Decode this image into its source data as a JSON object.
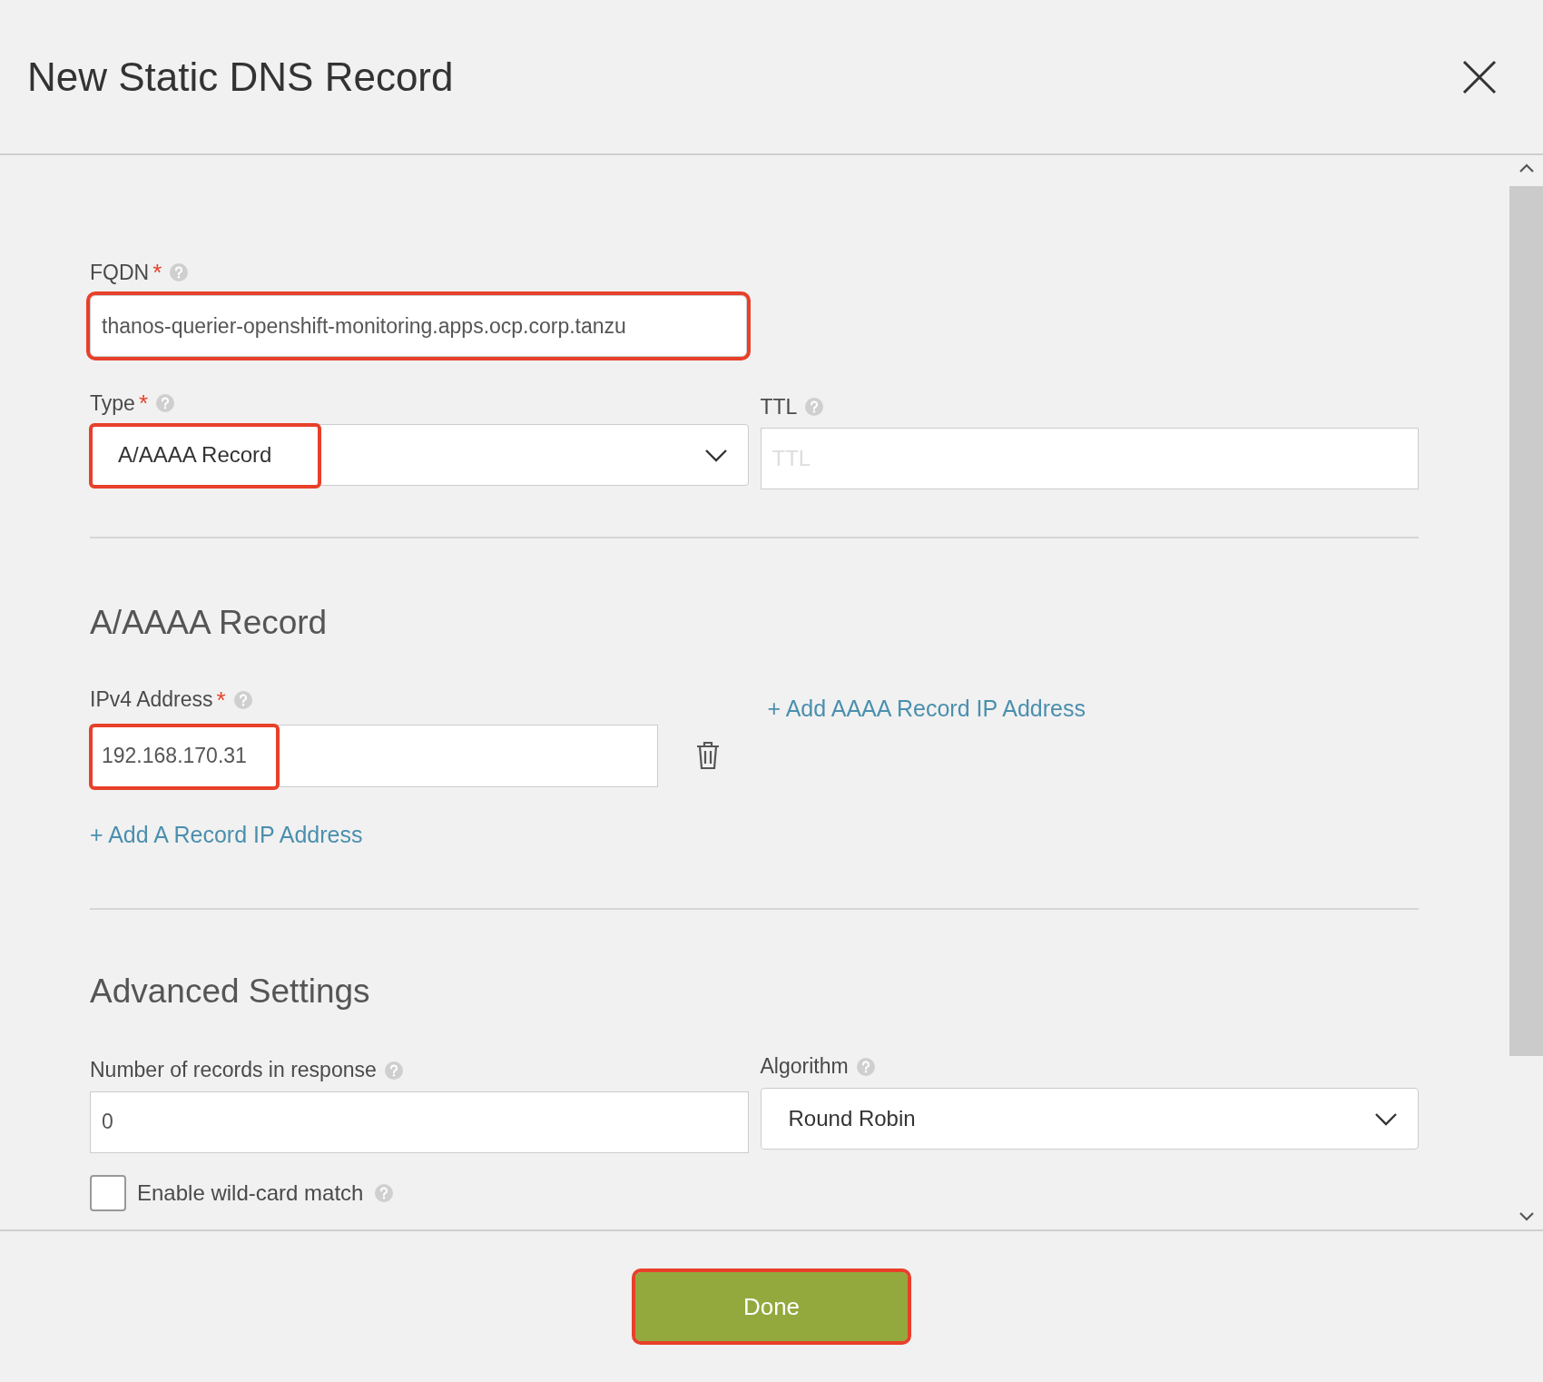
{
  "dialog": {
    "title": "New Static DNS Record"
  },
  "fqdn": {
    "label": "FQDN",
    "required_mark": "*",
    "value": "thanos-querier-openshift-monitoring.apps.ocp.corp.tanzu",
    "highlighted": true
  },
  "type": {
    "label": "Type",
    "required_mark": "*",
    "value": "A/AAAA Record",
    "highlighted": true
  },
  "ttl": {
    "label": "TTL",
    "placeholder": "TTL"
  },
  "a_record": {
    "heading": "A/AAAA Record",
    "ipv4": {
      "label": "IPv4 Address",
      "required_mark": "*",
      "value": "192.168.170.31",
      "highlighted": true
    },
    "add_a_link": "+ Add A Record IP Address",
    "add_aaaa_link": "+ Add AAAA Record IP Address"
  },
  "advanced": {
    "heading": "Advanced Settings",
    "records": {
      "label": "Number of records in response",
      "value": "0"
    },
    "algorithm": {
      "label": "Algorithm",
      "value": "Round Robin"
    },
    "wildcard": {
      "label": "Enable wild-card match",
      "checked": false
    }
  },
  "done_button": {
    "label": "Done",
    "highlighted": true
  }
}
